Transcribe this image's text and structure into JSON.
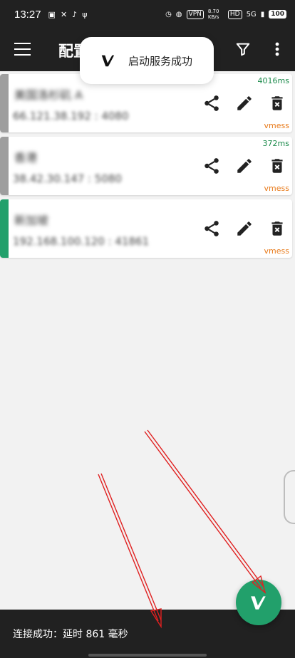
{
  "status_bar": {
    "time": "13:27",
    "vpn": "VPN",
    "speed": "8.70 KB/s",
    "network": "5G",
    "battery": "100"
  },
  "toolbar": {
    "title": "配置"
  },
  "toast": {
    "message": "启动服务成功",
    "logo": "v2ray-logo"
  },
  "servers": [
    {
      "name": "美国洛杉矶 A",
      "address": "66.121.38.192 : 4080",
      "delay": "4016ms",
      "type": "vmess",
      "indicator_color": "#9e9e9e"
    },
    {
      "name": "香港",
      "address": "38.42.30.147 : 5080",
      "delay": "372ms",
      "type": "vmess",
      "indicator_color": "#9e9e9e"
    },
    {
      "name": "新加坡",
      "address": "192.168.100.120 : 41861",
      "delay": "",
      "type": "vmess",
      "indicator_color": "#22a06b"
    }
  ],
  "bottom_bar": {
    "status_text": "连接成功：延时 861 毫秒"
  },
  "colors": {
    "bar": "#212121",
    "accent": "#22a06b",
    "delay": "#1a8a4a",
    "type": "#e87a1a",
    "annotation_arrow": "#e02020"
  }
}
